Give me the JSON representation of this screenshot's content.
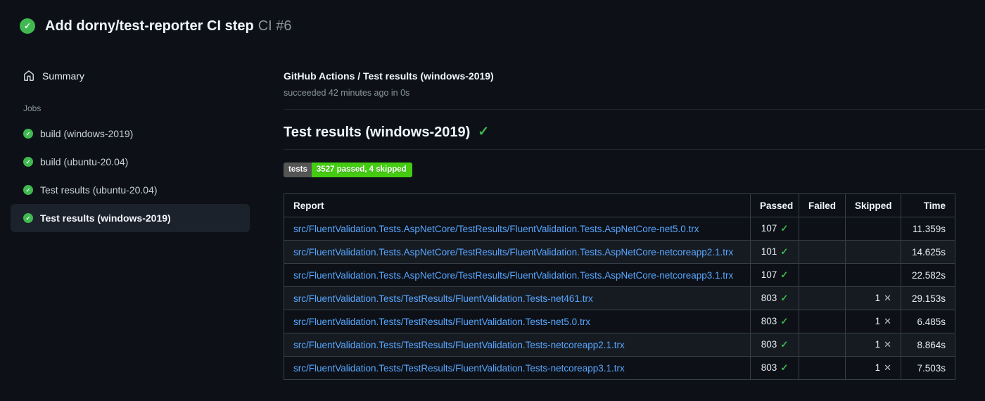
{
  "header": {
    "title": "Add dorny/test-reporter CI step",
    "run_number": "CI #6"
  },
  "sidebar": {
    "summary_label": "Summary",
    "jobs_label": "Jobs",
    "jobs": [
      {
        "label": "build (windows-2019)",
        "selected": false
      },
      {
        "label": "build (ubuntu-20.04)",
        "selected": false
      },
      {
        "label": "Test results (ubuntu-20.04)",
        "selected": false
      },
      {
        "label": "Test results (windows-2019)",
        "selected": true
      }
    ]
  },
  "main": {
    "breadcrumb": "GitHub Actions / Test results (windows-2019)",
    "status_line": "succeeded 42 minutes ago in 0s",
    "section_title": "Test results (windows-2019)",
    "badge": {
      "label": "tests",
      "value": "3527 passed, 4 skipped"
    },
    "table": {
      "columns": [
        "Report",
        "Passed",
        "Failed",
        "Skipped",
        "Time"
      ],
      "rows": [
        {
          "report": "src/FluentValidation.Tests.AspNetCore/TestResults/FluentValidation.Tests.AspNetCore-net5.0.trx",
          "passed": "107",
          "failed": "",
          "skipped": "",
          "time": "11.359s"
        },
        {
          "report": "src/FluentValidation.Tests.AspNetCore/TestResults/FluentValidation.Tests.AspNetCore-netcoreapp2.1.trx",
          "passed": "101",
          "failed": "",
          "skipped": "",
          "time": "14.625s"
        },
        {
          "report": "src/FluentValidation.Tests.AspNetCore/TestResults/FluentValidation.Tests.AspNetCore-netcoreapp3.1.trx",
          "passed": "107",
          "failed": "",
          "skipped": "",
          "time": "22.582s"
        },
        {
          "report": "src/FluentValidation.Tests/TestResults/FluentValidation.Tests-net461.trx",
          "passed": "803",
          "failed": "",
          "skipped": "1",
          "time": "29.153s"
        },
        {
          "report": "src/FluentValidation.Tests/TestResults/FluentValidation.Tests-net5.0.trx",
          "passed": "803",
          "failed": "",
          "skipped": "1",
          "time": "6.485s"
        },
        {
          "report": "src/FluentValidation.Tests/TestResults/FluentValidation.Tests-netcoreapp2.1.trx",
          "passed": "803",
          "failed": "",
          "skipped": "1",
          "time": "8.864s"
        },
        {
          "report": "src/FluentValidation.Tests/TestResults/FluentValidation.Tests-netcoreapp3.1.trx",
          "passed": "803",
          "failed": "",
          "skipped": "1",
          "time": "7.503s"
        }
      ]
    }
  },
  "icons": {
    "success_check": "✓",
    "skip_cross": "✕",
    "home": "home-icon"
  },
  "colors": {
    "success_green": "#3fb950",
    "link_blue": "#58a6ff",
    "badge_label_bg": "#555555",
    "badge_value_bg": "#44cc11",
    "page_bg": "#0d1117",
    "row_alt_bg": "#161b22"
  }
}
